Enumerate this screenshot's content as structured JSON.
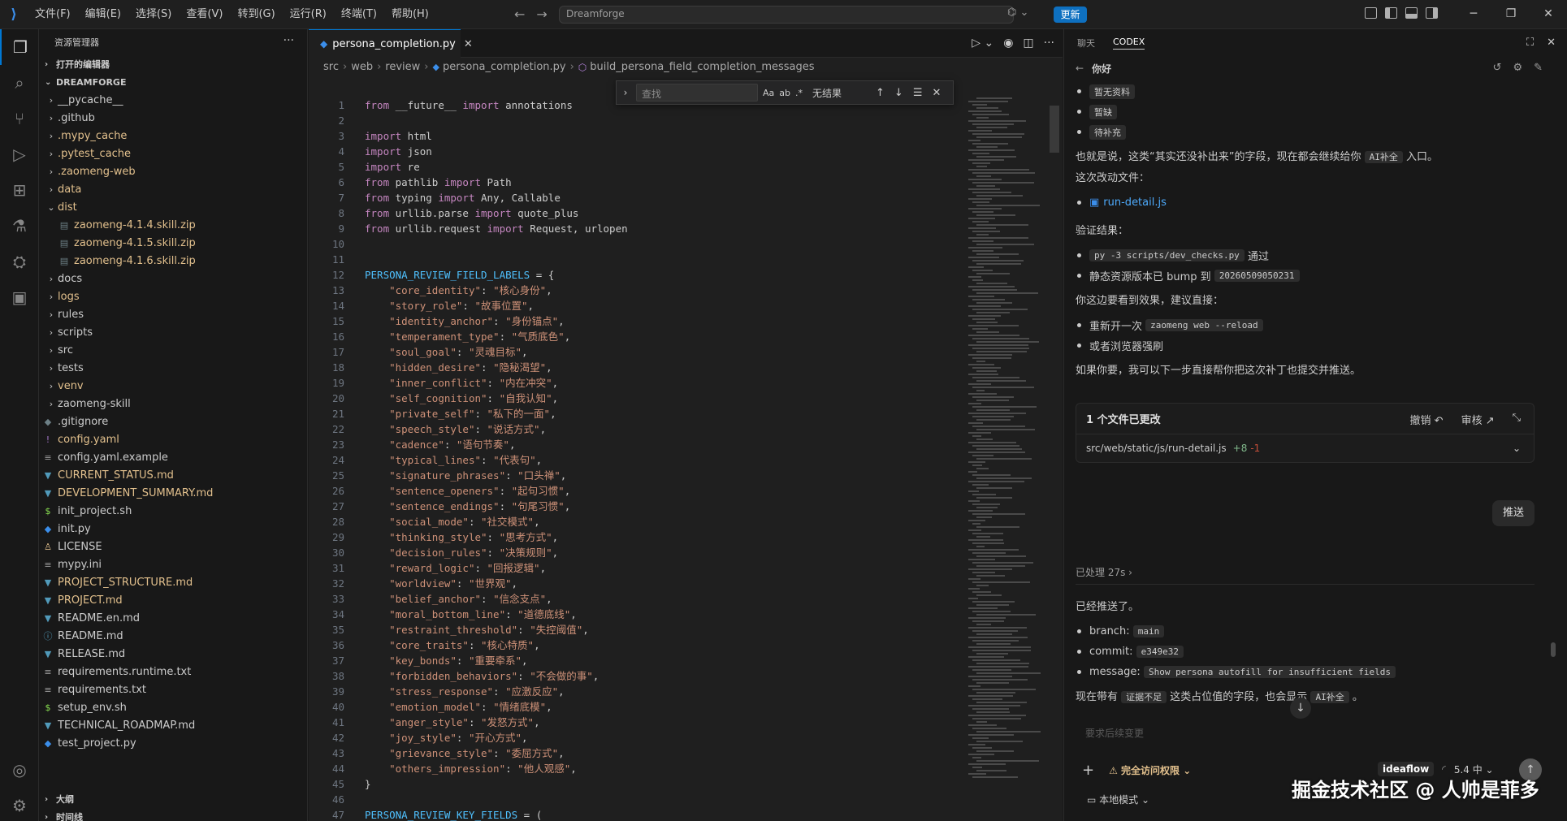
{
  "titlebar": {
    "menu": [
      "文件(F)",
      "编辑(E)",
      "选择(S)",
      "查看(V)",
      "转到(G)",
      "运行(R)",
      "终端(T)",
      "帮助(H)"
    ],
    "command_center": "Dreamforge",
    "update_label": "更新"
  },
  "sidebar": {
    "header": "资源管理器",
    "open_editors": "打开的编辑器",
    "root": "DREAMFORGE",
    "items": [
      {
        "label": "__pycache__",
        "type": "folder",
        "open": false,
        "indent": 1
      },
      {
        "label": ".github",
        "type": "folder",
        "open": false,
        "indent": 1
      },
      {
        "label": ".mypy_cache",
        "type": "folder",
        "open": false,
        "indent": 1,
        "modified": true
      },
      {
        "label": ".pytest_cache",
        "type": "folder",
        "open": false,
        "indent": 1,
        "modified": true
      },
      {
        "label": ".zaomeng-web",
        "type": "folder",
        "open": false,
        "indent": 1,
        "modified": true
      },
      {
        "label": "data",
        "type": "folder",
        "open": false,
        "indent": 1,
        "modified": true
      },
      {
        "label": "dist",
        "type": "folder",
        "open": true,
        "indent": 1,
        "modified": true
      },
      {
        "label": "zaomeng-4.1.4.skill.zip",
        "type": "zip",
        "indent": 2,
        "modified": true
      },
      {
        "label": "zaomeng-4.1.5.skill.zip",
        "type": "zip",
        "indent": 2,
        "modified": true
      },
      {
        "label": "zaomeng-4.1.6.skill.zip",
        "type": "zip",
        "indent": 2,
        "modified": true
      },
      {
        "label": "docs",
        "type": "folder",
        "open": false,
        "indent": 1
      },
      {
        "label": "logs",
        "type": "folder",
        "open": false,
        "indent": 1,
        "modified": true
      },
      {
        "label": "rules",
        "type": "folder",
        "open": false,
        "indent": 1
      },
      {
        "label": "scripts",
        "type": "folder",
        "open": false,
        "indent": 1
      },
      {
        "label": "src",
        "type": "folder",
        "open": false,
        "indent": 1
      },
      {
        "label": "tests",
        "type": "folder",
        "open": false,
        "indent": 1
      },
      {
        "label": "venv",
        "type": "folder",
        "open": false,
        "indent": 1,
        "modified": true
      },
      {
        "label": "zaomeng-skill",
        "type": "folder",
        "open": false,
        "indent": 1
      },
      {
        "label": ".gitignore",
        "type": "gitignore",
        "indent": 1
      },
      {
        "label": "config.yaml",
        "type": "yaml",
        "indent": 1,
        "modified": true
      },
      {
        "label": "config.yaml.example",
        "type": "text",
        "indent": 1
      },
      {
        "label": "CURRENT_STATUS.md",
        "type": "md",
        "indent": 1,
        "modified": true
      },
      {
        "label": "DEVELOPMENT_SUMMARY.md",
        "type": "md",
        "indent": 1,
        "modified": true
      },
      {
        "label": "init_project.sh",
        "type": "sh",
        "indent": 1
      },
      {
        "label": "init.py",
        "type": "py",
        "indent": 1
      },
      {
        "label": "LICENSE",
        "type": "license",
        "indent": 1
      },
      {
        "label": "mypy.ini",
        "type": "text",
        "indent": 1
      },
      {
        "label": "PROJECT_STRUCTURE.md",
        "type": "md",
        "indent": 1,
        "modified": true
      },
      {
        "label": "PROJECT.md",
        "type": "md",
        "indent": 1,
        "modified": true
      },
      {
        "label": "README.en.md",
        "type": "md",
        "indent": 1
      },
      {
        "label": "README.md",
        "type": "info",
        "indent": 1
      },
      {
        "label": "RELEASE.md",
        "type": "md",
        "indent": 1
      },
      {
        "label": "requirements.runtime.txt",
        "type": "text",
        "indent": 1
      },
      {
        "label": "requirements.txt",
        "type": "text",
        "indent": 1
      },
      {
        "label": "setup_env.sh",
        "type": "sh",
        "indent": 1
      },
      {
        "label": "TECHNICAL_ROADMAP.md",
        "type": "md",
        "indent": 1
      },
      {
        "label": "test_project.py",
        "type": "py",
        "indent": 1
      }
    ],
    "outline": "大纲",
    "timeline": "时间线"
  },
  "editor": {
    "tab_label": "persona_completion.py",
    "breadcrumb": [
      "src",
      "web",
      "review",
      "persona_completion.py",
      "build_persona_field_completion_messages"
    ],
    "find": {
      "placeholder": "查找",
      "result": "无结果",
      "opt_case": "Aa",
      "opt_word": "ab",
      "opt_regex": ".*"
    },
    "lines": [
      [
        [
          "kw",
          "from"
        ],
        [
          "pl",
          " __future__ "
        ],
        [
          "kw",
          "import"
        ],
        [
          "pl",
          " annotations"
        ]
      ],
      [],
      [
        [
          "kw",
          "import"
        ],
        [
          "pl",
          " html"
        ]
      ],
      [
        [
          "kw",
          "import"
        ],
        [
          "pl",
          " json"
        ]
      ],
      [
        [
          "kw",
          "import"
        ],
        [
          "pl",
          " re"
        ]
      ],
      [
        [
          "kw",
          "from"
        ],
        [
          "pl",
          " pathlib "
        ],
        [
          "kw",
          "import"
        ],
        [
          "pl",
          " Path"
        ]
      ],
      [
        [
          "kw",
          "from"
        ],
        [
          "pl",
          " typing "
        ],
        [
          "kw",
          "import"
        ],
        [
          "pl",
          " Any, Callable"
        ]
      ],
      [
        [
          "kw",
          "from"
        ],
        [
          "pl",
          " urllib.parse "
        ],
        [
          "kw",
          "import"
        ],
        [
          "pl",
          " quote_plus"
        ]
      ],
      [
        [
          "kw",
          "from"
        ],
        [
          "pl",
          " urllib.request "
        ],
        [
          "kw",
          "import"
        ],
        [
          "pl",
          " Request, urlopen"
        ]
      ],
      [],
      [],
      [
        [
          "var",
          "PERSONA_REVIEW_FIELD_LABELS"
        ],
        [
          "pl",
          " = {"
        ]
      ],
      [
        [
          "pl",
          "    "
        ],
        [
          "str",
          "\"core_identity\""
        ],
        [
          "pl",
          ": "
        ],
        [
          "str",
          "\"核心身份\""
        ],
        [
          "pl",
          ","
        ]
      ],
      [
        [
          "pl",
          "    "
        ],
        [
          "str",
          "\"story_role\""
        ],
        [
          "pl",
          ": "
        ],
        [
          "str",
          "\"故事位置\""
        ],
        [
          "pl",
          ","
        ]
      ],
      [
        [
          "pl",
          "    "
        ],
        [
          "str",
          "\"identity_anchor\""
        ],
        [
          "pl",
          ": "
        ],
        [
          "str",
          "\"身份锚点\""
        ],
        [
          "pl",
          ","
        ]
      ],
      [
        [
          "pl",
          "    "
        ],
        [
          "str",
          "\"temperament_type\""
        ],
        [
          "pl",
          ": "
        ],
        [
          "str",
          "\"气质底色\""
        ],
        [
          "pl",
          ","
        ]
      ],
      [
        [
          "pl",
          "    "
        ],
        [
          "str",
          "\"soul_goal\""
        ],
        [
          "pl",
          ": "
        ],
        [
          "str",
          "\"灵魂目标\""
        ],
        [
          "pl",
          ","
        ]
      ],
      [
        [
          "pl",
          "    "
        ],
        [
          "str",
          "\"hidden_desire\""
        ],
        [
          "pl",
          ": "
        ],
        [
          "str",
          "\"隐秘渴望\""
        ],
        [
          "pl",
          ","
        ]
      ],
      [
        [
          "pl",
          "    "
        ],
        [
          "str",
          "\"inner_conflict\""
        ],
        [
          "pl",
          ": "
        ],
        [
          "str",
          "\"内在冲突\""
        ],
        [
          "pl",
          ","
        ]
      ],
      [
        [
          "pl",
          "    "
        ],
        [
          "str",
          "\"self_cognition\""
        ],
        [
          "pl",
          ": "
        ],
        [
          "str",
          "\"自我认知\""
        ],
        [
          "pl",
          ","
        ]
      ],
      [
        [
          "pl",
          "    "
        ],
        [
          "str",
          "\"private_self\""
        ],
        [
          "pl",
          ": "
        ],
        [
          "str",
          "\"私下的一面\""
        ],
        [
          "pl",
          ","
        ]
      ],
      [
        [
          "pl",
          "    "
        ],
        [
          "str",
          "\"speech_style\""
        ],
        [
          "pl",
          ": "
        ],
        [
          "str",
          "\"说话方式\""
        ],
        [
          "pl",
          ","
        ]
      ],
      [
        [
          "pl",
          "    "
        ],
        [
          "str",
          "\"cadence\""
        ],
        [
          "pl",
          ": "
        ],
        [
          "str",
          "\"语句节奏\""
        ],
        [
          "pl",
          ","
        ]
      ],
      [
        [
          "pl",
          "    "
        ],
        [
          "str",
          "\"typical_lines\""
        ],
        [
          "pl",
          ": "
        ],
        [
          "str",
          "\"代表句\""
        ],
        [
          "pl",
          ","
        ]
      ],
      [
        [
          "pl",
          "    "
        ],
        [
          "str",
          "\"signature_phrases\""
        ],
        [
          "pl",
          ": "
        ],
        [
          "str",
          "\"口头禅\""
        ],
        [
          "pl",
          ","
        ]
      ],
      [
        [
          "pl",
          "    "
        ],
        [
          "str",
          "\"sentence_openers\""
        ],
        [
          "pl",
          ": "
        ],
        [
          "str",
          "\"起句习惯\""
        ],
        [
          "pl",
          ","
        ]
      ],
      [
        [
          "pl",
          "    "
        ],
        [
          "str",
          "\"sentence_endings\""
        ],
        [
          "pl",
          ": "
        ],
        [
          "str",
          "\"句尾习惯\""
        ],
        [
          "pl",
          ","
        ]
      ],
      [
        [
          "pl",
          "    "
        ],
        [
          "str",
          "\"social_mode\""
        ],
        [
          "pl",
          ": "
        ],
        [
          "str",
          "\"社交模式\""
        ],
        [
          "pl",
          ","
        ]
      ],
      [
        [
          "pl",
          "    "
        ],
        [
          "str",
          "\"thinking_style\""
        ],
        [
          "pl",
          ": "
        ],
        [
          "str",
          "\"思考方式\""
        ],
        [
          "pl",
          ","
        ]
      ],
      [
        [
          "pl",
          "    "
        ],
        [
          "str",
          "\"decision_rules\""
        ],
        [
          "pl",
          ": "
        ],
        [
          "str",
          "\"决策规则\""
        ],
        [
          "pl",
          ","
        ]
      ],
      [
        [
          "pl",
          "    "
        ],
        [
          "str",
          "\"reward_logic\""
        ],
        [
          "pl",
          ": "
        ],
        [
          "str",
          "\"回报逻辑\""
        ],
        [
          "pl",
          ","
        ]
      ],
      [
        [
          "pl",
          "    "
        ],
        [
          "str",
          "\"worldview\""
        ],
        [
          "pl",
          ": "
        ],
        [
          "str",
          "\"世界观\""
        ],
        [
          "pl",
          ","
        ]
      ],
      [
        [
          "pl",
          "    "
        ],
        [
          "str",
          "\"belief_anchor\""
        ],
        [
          "pl",
          ": "
        ],
        [
          "str",
          "\"信念支点\""
        ],
        [
          "pl",
          ","
        ]
      ],
      [
        [
          "pl",
          "    "
        ],
        [
          "str",
          "\"moral_bottom_line\""
        ],
        [
          "pl",
          ": "
        ],
        [
          "str",
          "\"道德底线\""
        ],
        [
          "pl",
          ","
        ]
      ],
      [
        [
          "pl",
          "    "
        ],
        [
          "str",
          "\"restraint_threshold\""
        ],
        [
          "pl",
          ": "
        ],
        [
          "str",
          "\"失控阈值\""
        ],
        [
          "pl",
          ","
        ]
      ],
      [
        [
          "pl",
          "    "
        ],
        [
          "str",
          "\"core_traits\""
        ],
        [
          "pl",
          ": "
        ],
        [
          "str",
          "\"核心特质\""
        ],
        [
          "pl",
          ","
        ]
      ],
      [
        [
          "pl",
          "    "
        ],
        [
          "str",
          "\"key_bonds\""
        ],
        [
          "pl",
          ": "
        ],
        [
          "str",
          "\"重要牵系\""
        ],
        [
          "pl",
          ","
        ]
      ],
      [
        [
          "pl",
          "    "
        ],
        [
          "str",
          "\"forbidden_behaviors\""
        ],
        [
          "pl",
          ": "
        ],
        [
          "str",
          "\"不会做的事\""
        ],
        [
          "pl",
          ","
        ]
      ],
      [
        [
          "pl",
          "    "
        ],
        [
          "str",
          "\"stress_response\""
        ],
        [
          "pl",
          ": "
        ],
        [
          "str",
          "\"应激反应\""
        ],
        [
          "pl",
          ","
        ]
      ],
      [
        [
          "pl",
          "    "
        ],
        [
          "str",
          "\"emotion_model\""
        ],
        [
          "pl",
          ": "
        ],
        [
          "str",
          "\"情绪底模\""
        ],
        [
          "pl",
          ","
        ]
      ],
      [
        [
          "pl",
          "    "
        ],
        [
          "str",
          "\"anger_style\""
        ],
        [
          "pl",
          ": "
        ],
        [
          "str",
          "\"发怒方式\""
        ],
        [
          "pl",
          ","
        ]
      ],
      [
        [
          "pl",
          "    "
        ],
        [
          "str",
          "\"joy_style\""
        ],
        [
          "pl",
          ": "
        ],
        [
          "str",
          "\"开心方式\""
        ],
        [
          "pl",
          ","
        ]
      ],
      [
        [
          "pl",
          "    "
        ],
        [
          "str",
          "\"grievance_style\""
        ],
        [
          "pl",
          ": "
        ],
        [
          "str",
          "\"委屈方式\""
        ],
        [
          "pl",
          ","
        ]
      ],
      [
        [
          "pl",
          "    "
        ],
        [
          "str",
          "\"others_impression\""
        ],
        [
          "pl",
          ": "
        ],
        [
          "str",
          "\"他人观感\""
        ],
        [
          "pl",
          ","
        ]
      ],
      [
        [
          "pl",
          "}"
        ]
      ],
      [],
      [
        [
          "var",
          "PERSONA_REVIEW_KEY_FIELDS"
        ],
        [
          "pl",
          " = ("
        ]
      ]
    ]
  },
  "chat": {
    "tab_chat": "聊天",
    "tab_codex": "CODEX",
    "thread_title": "你好",
    "bullets_top": [
      "暂无资料",
      "暂缺",
      "待补充"
    ],
    "para1_a": "也就是说，这类“其实还没补出来”的字段，现在都会继续给你",
    "para1_chip": "AI补全",
    "para1_b": "入口。",
    "files_label": "这次改动文件：",
    "file_link": "run-detail.js",
    "verify_label": "验证结果：",
    "verify_cmd": "py -3 scripts/dev_checks.py",
    "verify_pass": "通过",
    "bump_text": "静态资源版本已 bump 到",
    "bump_value": "20260509050231",
    "see_label": "你这边要看到效果，建议直接：",
    "restart_text": "重新开一次",
    "restart_cmd": "zaomeng web --reload",
    "refresh_text": "或者浏览器强刷",
    "next_text": "如果你要，我可以下一步直接帮你把这次补丁也提交并推送。",
    "card_title": "1 个文件已更改",
    "card_undo": "撤销 ↶",
    "card_review": "审核 ↗",
    "card_file": "src/web/static/js/run-detail.js",
    "card_plus": "+8",
    "card_minus": "-1",
    "push_label": "推送",
    "processed": "已处理 27s  ›",
    "pushed": "已经推送了。",
    "branch_label": "branch:",
    "branch_value": "main",
    "commit_label": "commit:",
    "commit_value": "e349e32",
    "message_label": "message:",
    "message_value": "Show persona autofill for insufficient fields",
    "final_a": "现在带有",
    "final_chip1": "证据不足",
    "final_b": "这类占位值的字段，也会显示",
    "final_chip2": "AI补全",
    "final_c": "。",
    "input_placeholder": "要求后续变更",
    "permission": "完全访问权限 ⌄",
    "model": "ideaflow",
    "level": "5.4 中 ⌄",
    "local_mode": "本地模式 ⌄"
  },
  "watermark": "掘金技术社区 @ 人帅是菲多"
}
